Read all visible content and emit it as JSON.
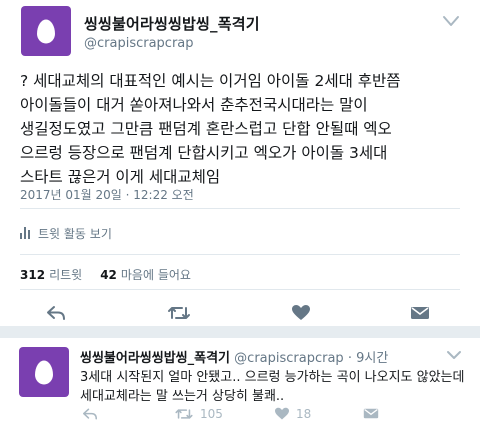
{
  "main_tweet": {
    "display_name": "씽씽불어라씽씽밥씽_폭격기",
    "handle": "@crapiscrapcrap",
    "text": "? 세대교체의 대표적인 예시는 이거임 아이돌 2세대 후반쯤\n아이돌들이 대거 쏟아져나와서 춘추전국시대라는 말이\n생길정도였고 그만큼 팬덤계 혼란스럽고 단합 안될때 엑오\n으르렁 등장으로 팬덤계 단합시키고 엑오가 아이돌 3세대\n스타트 끊은거 이게 세대교체임",
    "timestamp": "2017년 01월 20일 · 12:22 오전",
    "activity_label": "트윗 활동 보기",
    "retweets_count": "312",
    "retweets_label": "리트윗",
    "likes_count": "42",
    "likes_label": "마음에 들어요"
  },
  "reply_tweet": {
    "display_name": "씽씽불어라씽씽밥씽_폭격기",
    "handle_time": "@crapiscrapcrap · 9시간",
    "text": "3세대 시작된지 얼마 안됐고.. 으르렁 능가하는 곡이 나오지도 않았는데\n세대교체라는 말 쓰는거 상당히 불쾌..",
    "retweet_count": "105",
    "like_count": "18"
  },
  "icons": {
    "avatar": "egg-avatar",
    "menu": "chevron-down-icon",
    "activity": "bar-chart-icon",
    "reply": "reply-icon",
    "retweet": "retweet-icon",
    "like": "heart-icon",
    "dm": "envelope-icon"
  },
  "colors": {
    "avatar_bg": "#7a3fb0",
    "secondary_text": "#657786",
    "action_icon": "#657786",
    "reply_action_icon": "#aab8c2",
    "divider": "#e1e8ed",
    "band": "#e6ecf0"
  }
}
